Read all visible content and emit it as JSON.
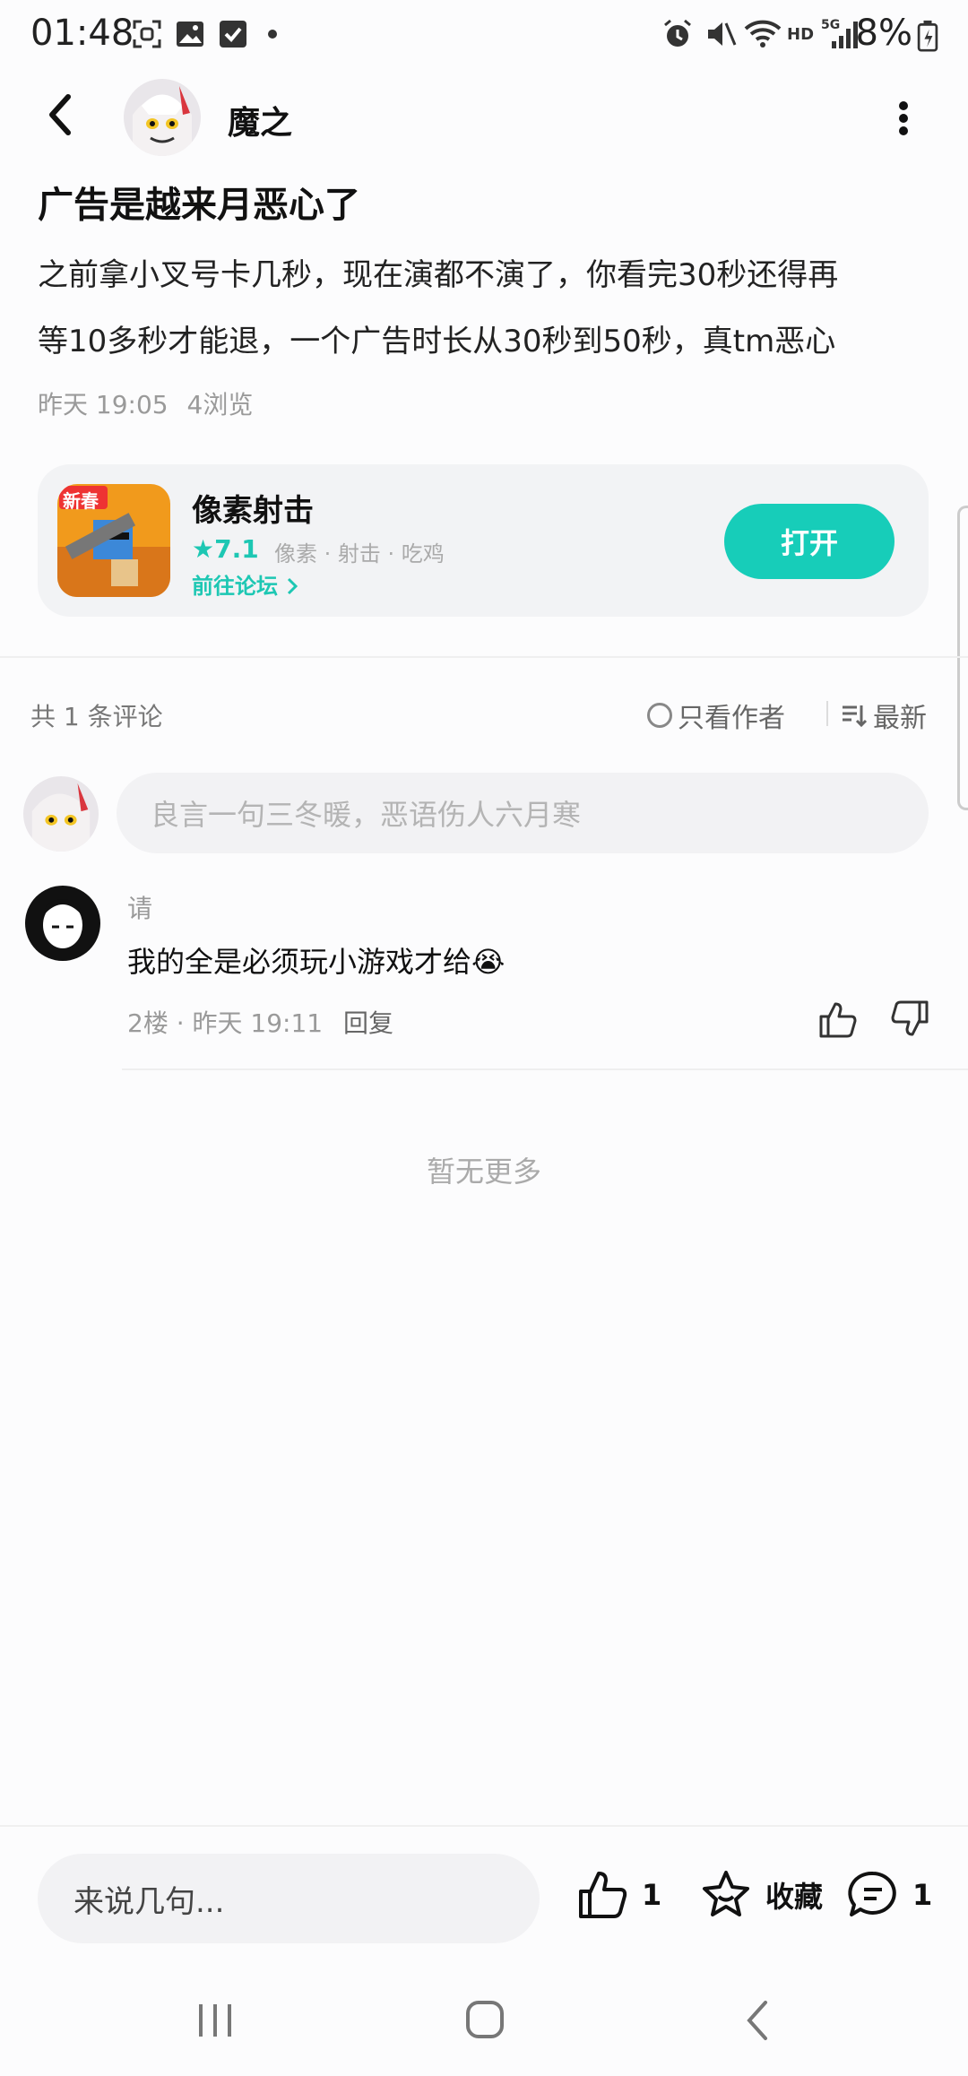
{
  "status_bar": {
    "time": "01:48",
    "network": "HD",
    "signal": "5G",
    "battery": "8%"
  },
  "post": {
    "author": "魔之",
    "title": "广告是越来月恶心了",
    "body_line1": "之前拿小叉号卡几秒，现在演都不演了，你看完30秒还得再",
    "body_line2": "等10多秒才能退，一个广告时长从30秒到50秒，真tm恶心",
    "time": "昨天 19:05",
    "views": "4浏览"
  },
  "game_card": {
    "name": "像素射击",
    "rating": "★7.1",
    "tags": "像素 · 射击 · 吃鸡",
    "forum_link": "前往论坛",
    "icon_badge": "新春",
    "open_label": "打开"
  },
  "comments_bar": {
    "count": "共 1 条评论",
    "only_author": "只看作者",
    "sort": "最新"
  },
  "comment_input": {
    "placeholder": "良言一句三冬暖，恶语伤人六月寒"
  },
  "comments": [
    {
      "user": "请",
      "text": "我的全是必须玩小游戏才给😭",
      "floor_time": "2楼 · 昨天 19:11",
      "reply": "回复"
    }
  ],
  "no_more": "暂无更多",
  "bottom_bar": {
    "input_placeholder": "来说几句...",
    "likes": "1",
    "favorite_label": "收藏",
    "comments": "1"
  },
  "colors": {
    "accent": "#17cdb9",
    "card_bg": "#f2f3f5"
  },
  "icons": [
    "back-icon",
    "more-icon",
    "only-author-circle-icon",
    "sort-icon",
    "thumbs-up-icon",
    "thumbs-down-icon",
    "star-icon",
    "comment-bubble-icon"
  ]
}
